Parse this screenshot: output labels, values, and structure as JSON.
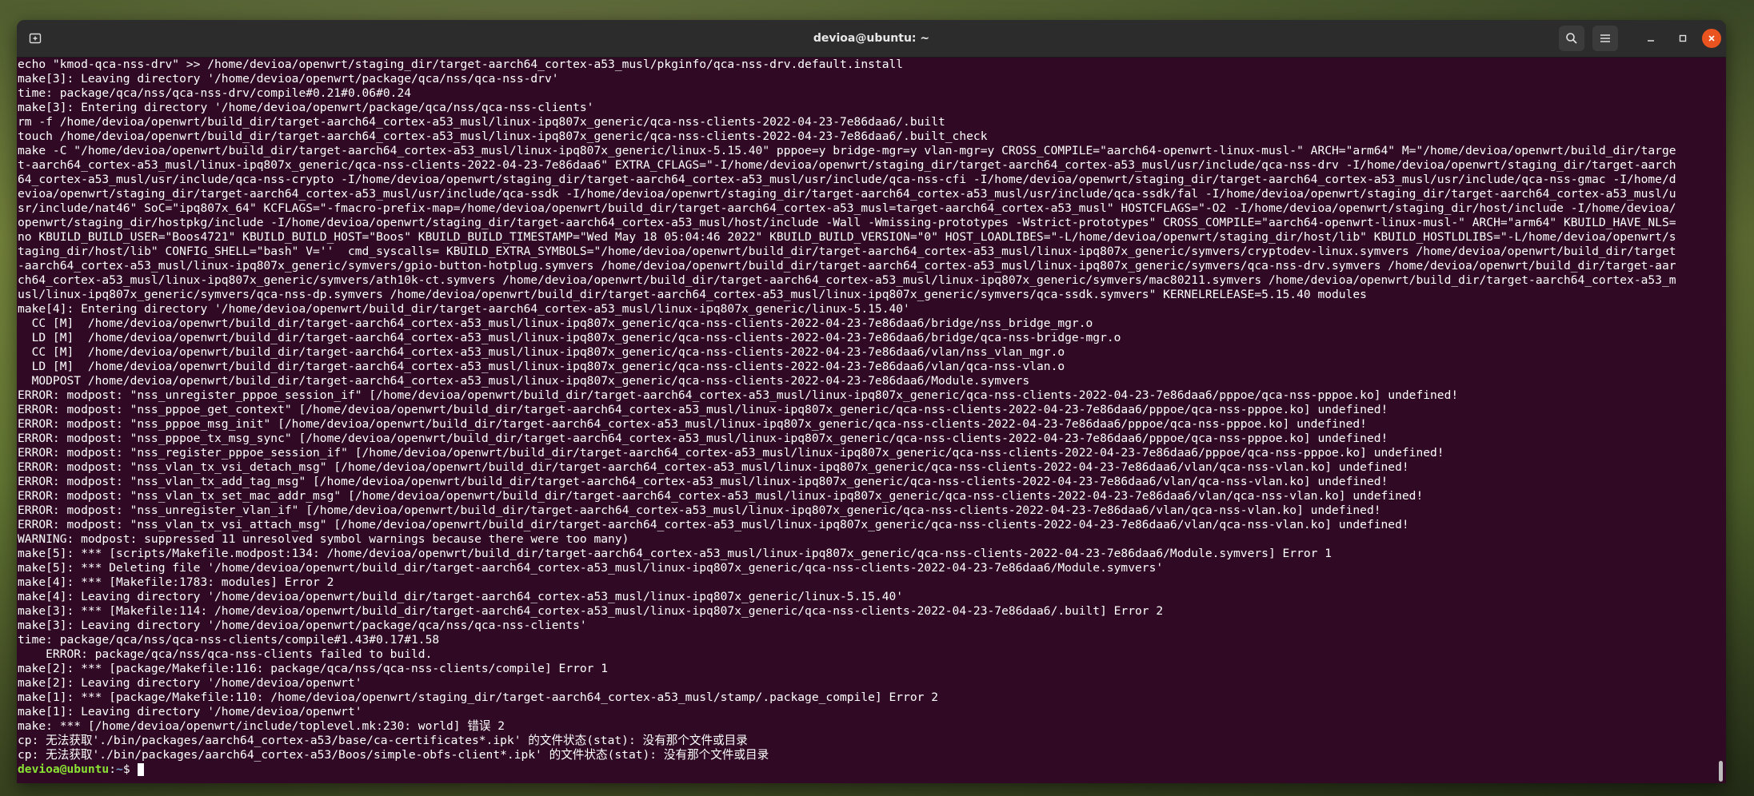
{
  "window": {
    "title": "devioa@ubuntu: ~"
  },
  "icons": {
    "new_tab": "new-tab-icon",
    "search": "search-icon",
    "menu": "hamburger-menu-icon",
    "minimize": "minimize-icon",
    "maximize": "maximize-icon",
    "close": "close-icon"
  },
  "colors": {
    "terminal_bg": "#300a24",
    "close_button": "#e95420",
    "prompt_user": "#8ae234",
    "prompt_path": "#729fcf"
  },
  "terminal": {
    "lines": [
      "echo \"kmod-qca-nss-drv\" >> /home/devioa/openwrt/staging_dir/target-aarch64_cortex-a53_musl/pkginfo/qca-nss-drv.default.install",
      "make[3]: Leaving directory '/home/devioa/openwrt/package/qca/nss/qca-nss-drv'",
      "time: package/qca/nss/qca-nss-drv/compile#0.21#0.06#0.24",
      "make[3]: Entering directory '/home/devioa/openwrt/package/qca/nss/qca-nss-clients'",
      "rm -f /home/devioa/openwrt/build_dir/target-aarch64_cortex-a53_musl/linux-ipq807x_generic/qca-nss-clients-2022-04-23-7e86daa6/.built",
      "touch /home/devioa/openwrt/build_dir/target-aarch64_cortex-a53_musl/linux-ipq807x_generic/qca-nss-clients-2022-04-23-7e86daa6/.built_check",
      "make -C \"/home/devioa/openwrt/build_dir/target-aarch64_cortex-a53_musl/linux-ipq807x_generic/linux-5.15.40\" pppoe=y bridge-mgr=y vlan-mgr=y CROSS_COMPILE=\"aarch64-openwrt-linux-musl-\" ARCH=\"arm64\" M=\"/home/devioa/openwrt/build_dir/targe",
      "t-aarch64_cortex-a53_musl/linux-ipq807x_generic/qca-nss-clients-2022-04-23-7e86daa6\" EXTRA_CFLAGS=\"-I/home/devioa/openwrt/staging_dir/target-aarch64_cortex-a53_musl/usr/include/qca-nss-drv -I/home/devioa/openwrt/staging_dir/target-aarch",
      "64_cortex-a53_musl/usr/include/qca-nss-crypto -I/home/devioa/openwrt/staging_dir/target-aarch64_cortex-a53_musl/usr/include/qca-nss-cfi -I/home/devioa/openwrt/staging_dir/target-aarch64_cortex-a53_musl/usr/include/qca-nss-gmac -I/home/d",
      "evioa/openwrt/staging_dir/target-aarch64_cortex-a53_musl/usr/include/qca-ssdk -I/home/devioa/openwrt/staging_dir/target-aarch64_cortex-a53_musl/usr/include/qca-ssdk/fal -I/home/devioa/openwrt/staging_dir/target-aarch64_cortex-a53_musl/u",
      "sr/include/nat46\" SoC=\"ipq807x_64\" KCFLAGS=\"-fmacro-prefix-map=/home/devioa/openwrt/build_dir/target-aarch64_cortex-a53_musl=target-aarch64_cortex-a53_musl\" HOSTCFLAGS=\"-O2 -I/home/devioa/openwrt/staging_dir/host/include -I/home/devioa/",
      "openwrt/staging_dir/hostpkg/include -I/home/devioa/openwrt/staging_dir/target-aarch64_cortex-a53_musl/host/include -Wall -Wmissing-prototypes -Wstrict-prototypes\" CROSS_COMPILE=\"aarch64-openwrt-linux-musl-\" ARCH=\"arm64\" KBUILD_HAVE_NLS=",
      "no KBUILD_BUILD_USER=\"Boos4721\" KBUILD_BUILD_HOST=\"Boos\" KBUILD_BUILD_TIMESTAMP=\"Wed May 18 05:04:46 2022\" KBUILD_BUILD_VERSION=\"0\" HOST_LOADLIBES=\"-L/home/devioa/openwrt/staging_dir/host/lib\" KBUILD_HOSTLDLIBS=\"-L/home/devioa/openwrt/s",
      "taging_dir/host/lib\" CONFIG_SHELL=\"bash\" V=''  cmd_syscalls= KBUILD_EXTRA_SYMBOLS=\"/home/devioa/openwrt/build_dir/target-aarch64_cortex-a53_musl/linux-ipq807x_generic/symvers/cryptodev-linux.symvers /home/devioa/openwrt/build_dir/target",
      "-aarch64_cortex-a53_musl/linux-ipq807x_generic/symvers/gpio-button-hotplug.symvers /home/devioa/openwrt/build_dir/target-aarch64_cortex-a53_musl/linux-ipq807x_generic/symvers/qca-nss-drv.symvers /home/devioa/openwrt/build_dir/target-aar",
      "ch64_cortex-a53_musl/linux-ipq807x_generic/symvers/ath10k-ct.symvers /home/devioa/openwrt/build_dir/target-aarch64_cortex-a53_musl/linux-ipq807x_generic/symvers/mac80211.symvers /home/devioa/openwrt/build_dir/target-aarch64_cortex-a53_m",
      "usl/linux-ipq807x_generic/symvers/qca-nss-dp.symvers /home/devioa/openwrt/build_dir/target-aarch64_cortex-a53_musl/linux-ipq807x_generic/symvers/qca-ssdk.symvers\" KERNELRELEASE=5.15.40 modules",
      "make[4]: Entering directory '/home/devioa/openwrt/build_dir/target-aarch64_cortex-a53_musl/linux-ipq807x_generic/linux-5.15.40'",
      "  CC [M]  /home/devioa/openwrt/build_dir/target-aarch64_cortex-a53_musl/linux-ipq807x_generic/qca-nss-clients-2022-04-23-7e86daa6/bridge/nss_bridge_mgr.o",
      "  LD [M]  /home/devioa/openwrt/build_dir/target-aarch64_cortex-a53_musl/linux-ipq807x_generic/qca-nss-clients-2022-04-23-7e86daa6/bridge/qca-nss-bridge-mgr.o",
      "  CC [M]  /home/devioa/openwrt/build_dir/target-aarch64_cortex-a53_musl/linux-ipq807x_generic/qca-nss-clients-2022-04-23-7e86daa6/vlan/nss_vlan_mgr.o",
      "  LD [M]  /home/devioa/openwrt/build_dir/target-aarch64_cortex-a53_musl/linux-ipq807x_generic/qca-nss-clients-2022-04-23-7e86daa6/vlan/qca-nss-vlan.o",
      "  MODPOST /home/devioa/openwrt/build_dir/target-aarch64_cortex-a53_musl/linux-ipq807x_generic/qca-nss-clients-2022-04-23-7e86daa6/Module.symvers",
      "ERROR: modpost: \"nss_unregister_pppoe_session_if\" [/home/devioa/openwrt/build_dir/target-aarch64_cortex-a53_musl/linux-ipq807x_generic/qca-nss-clients-2022-04-23-7e86daa6/pppoe/qca-nss-pppoe.ko] undefined!",
      "ERROR: modpost: \"nss_pppoe_get_context\" [/home/devioa/openwrt/build_dir/target-aarch64_cortex-a53_musl/linux-ipq807x_generic/qca-nss-clients-2022-04-23-7e86daa6/pppoe/qca-nss-pppoe.ko] undefined!",
      "ERROR: modpost: \"nss_pppoe_msg_init\" [/home/devioa/openwrt/build_dir/target-aarch64_cortex-a53_musl/linux-ipq807x_generic/qca-nss-clients-2022-04-23-7e86daa6/pppoe/qca-nss-pppoe.ko] undefined!",
      "ERROR: modpost: \"nss_pppoe_tx_msg_sync\" [/home/devioa/openwrt/build_dir/target-aarch64_cortex-a53_musl/linux-ipq807x_generic/qca-nss-clients-2022-04-23-7e86daa6/pppoe/qca-nss-pppoe.ko] undefined!",
      "ERROR: modpost: \"nss_register_pppoe_session_if\" [/home/devioa/openwrt/build_dir/target-aarch64_cortex-a53_musl/linux-ipq807x_generic/qca-nss-clients-2022-04-23-7e86daa6/pppoe/qca-nss-pppoe.ko] undefined!",
      "ERROR: modpost: \"nss_vlan_tx_vsi_detach_msg\" [/home/devioa/openwrt/build_dir/target-aarch64_cortex-a53_musl/linux-ipq807x_generic/qca-nss-clients-2022-04-23-7e86daa6/vlan/qca-nss-vlan.ko] undefined!",
      "ERROR: modpost: \"nss_vlan_tx_add_tag_msg\" [/home/devioa/openwrt/build_dir/target-aarch64_cortex-a53_musl/linux-ipq807x_generic/qca-nss-clients-2022-04-23-7e86daa6/vlan/qca-nss-vlan.ko] undefined!",
      "ERROR: modpost: \"nss_vlan_tx_set_mac_addr_msg\" [/home/devioa/openwrt/build_dir/target-aarch64_cortex-a53_musl/linux-ipq807x_generic/qca-nss-clients-2022-04-23-7e86daa6/vlan/qca-nss-vlan.ko] undefined!",
      "ERROR: modpost: \"nss_unregister_vlan_if\" [/home/devioa/openwrt/build_dir/target-aarch64_cortex-a53_musl/linux-ipq807x_generic/qca-nss-clients-2022-04-23-7e86daa6/vlan/qca-nss-vlan.ko] undefined!",
      "ERROR: modpost: \"nss_vlan_tx_vsi_attach_msg\" [/home/devioa/openwrt/build_dir/target-aarch64_cortex-a53_musl/linux-ipq807x_generic/qca-nss-clients-2022-04-23-7e86daa6/vlan/qca-nss-vlan.ko] undefined!",
      "WARNING: modpost: suppressed 11 unresolved symbol warnings because there were too many)",
      "make[5]: *** [scripts/Makefile.modpost:134: /home/devioa/openwrt/build_dir/target-aarch64_cortex-a53_musl/linux-ipq807x_generic/qca-nss-clients-2022-04-23-7e86daa6/Module.symvers] Error 1",
      "make[5]: *** Deleting file '/home/devioa/openwrt/build_dir/target-aarch64_cortex-a53_musl/linux-ipq807x_generic/qca-nss-clients-2022-04-23-7e86daa6/Module.symvers'",
      "make[4]: *** [Makefile:1783: modules] Error 2",
      "make[4]: Leaving directory '/home/devioa/openwrt/build_dir/target-aarch64_cortex-a53_musl/linux-ipq807x_generic/linux-5.15.40'",
      "make[3]: *** [Makefile:114: /home/devioa/openwrt/build_dir/target-aarch64_cortex-a53_musl/linux-ipq807x_generic/qca-nss-clients-2022-04-23-7e86daa6/.built] Error 2",
      "make[3]: Leaving directory '/home/devioa/openwrt/package/qca/nss/qca-nss-clients'",
      "time: package/qca/nss/qca-nss-clients/compile#1.43#0.17#1.58",
      "    ERROR: package/qca/nss/qca-nss-clients failed to build.",
      "make[2]: *** [package/Makefile:116: package/qca/nss/qca-nss-clients/compile] Error 1",
      "make[2]: Leaving directory '/home/devioa/openwrt'",
      "make[1]: *** [package/Makefile:110: /home/devioa/openwrt/staging_dir/target-aarch64_cortex-a53_musl/stamp/.package_compile] Error 2",
      "make[1]: Leaving directory '/home/devioa/openwrt'",
      "make: *** [/home/devioa/openwrt/include/toplevel.mk:230: world] 错误 2",
      "cp: 无法获取'./bin/packages/aarch64_cortex-a53/base/ca-certificates*.ipk' 的文件状态(stat): 没有那个文件或目录",
      "cp: 无法获取'./bin/packages/aarch64_cortex-a53/Boos/simple-obfs-client*.ipk' 的文件状态(stat): 没有那个文件或目录"
    ],
    "prompt": {
      "user_host": "devioa@ubuntu",
      "separator": ":",
      "path": "~",
      "symbol": "$ "
    }
  }
}
